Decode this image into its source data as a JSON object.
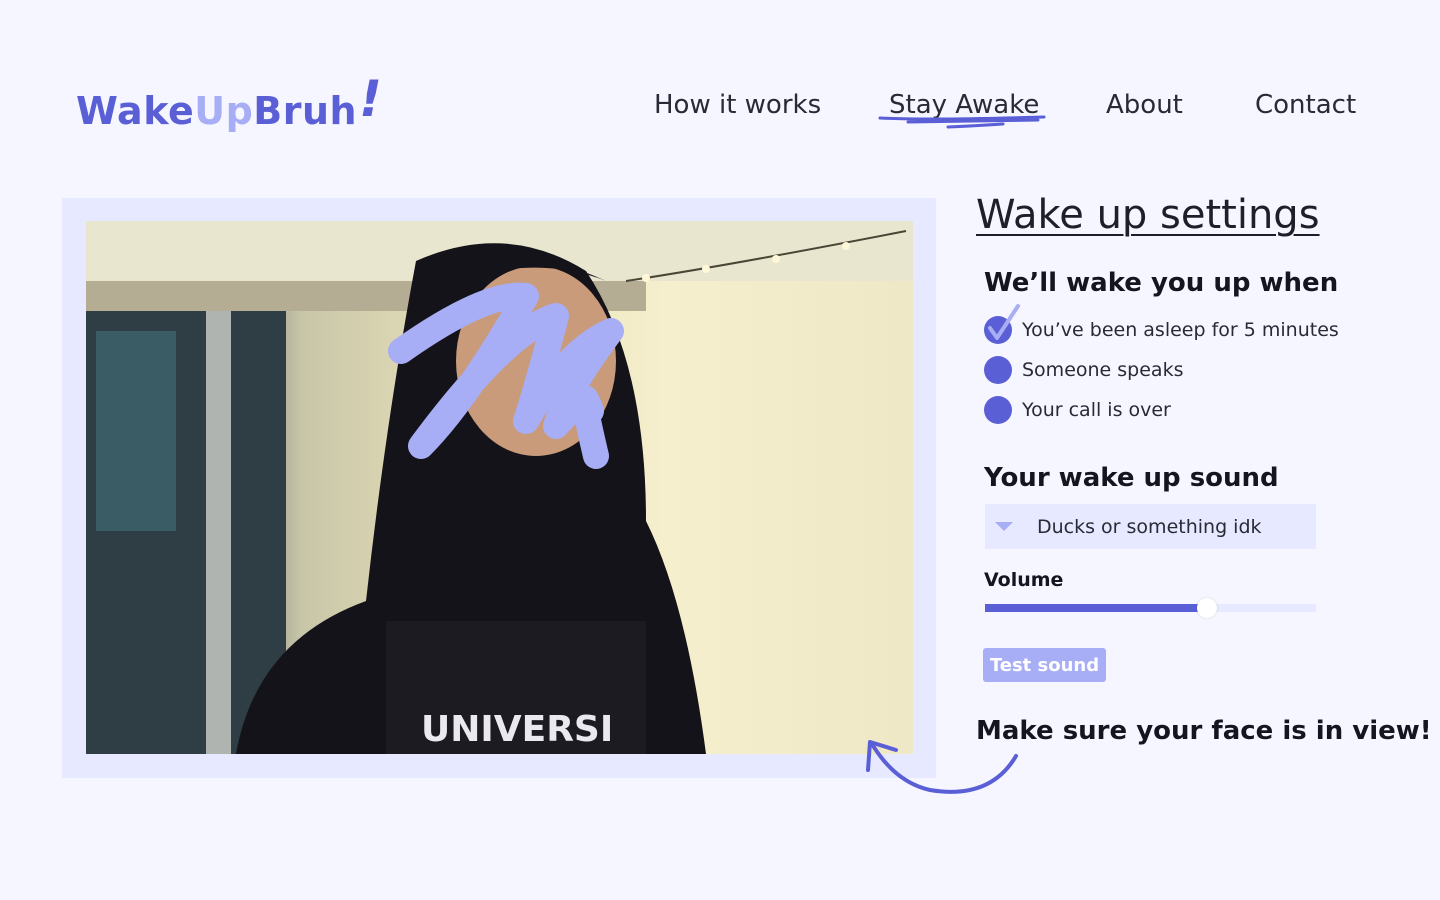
{
  "brand": {
    "part1": "Wake",
    "part2": "Up",
    "part3": "Bruh",
    "part4": "!"
  },
  "nav": {
    "how": "How it works",
    "stay": "Stay Awake",
    "about": "About",
    "contact": "Contact",
    "active": "Stay Awake"
  },
  "settings": {
    "title": "Wake up settings",
    "conditions_heading": "We’ll wake you up when",
    "conditions": [
      {
        "label": "You’ve been asleep for 5 minutes",
        "checked": true
      },
      {
        "label": "Someone speaks",
        "checked": false
      },
      {
        "label": "Your call is over",
        "checked": false
      }
    ],
    "sound_heading": "Your wake up sound",
    "sound_selected": "Ducks or something idk",
    "volume_label": "Volume",
    "volume_value": 0.67,
    "test_button": "Test sound"
  },
  "hint": "Make sure your face is in view!",
  "colors": {
    "background": "#f5f6ff",
    "accent": "#5b5fd6",
    "accent_light": "#a7aef5",
    "panel": "#e6e9ff"
  },
  "icons": {
    "check": "check-icon",
    "dropdown": "chevron-down-icon",
    "arrow": "curved-arrow-icon"
  }
}
